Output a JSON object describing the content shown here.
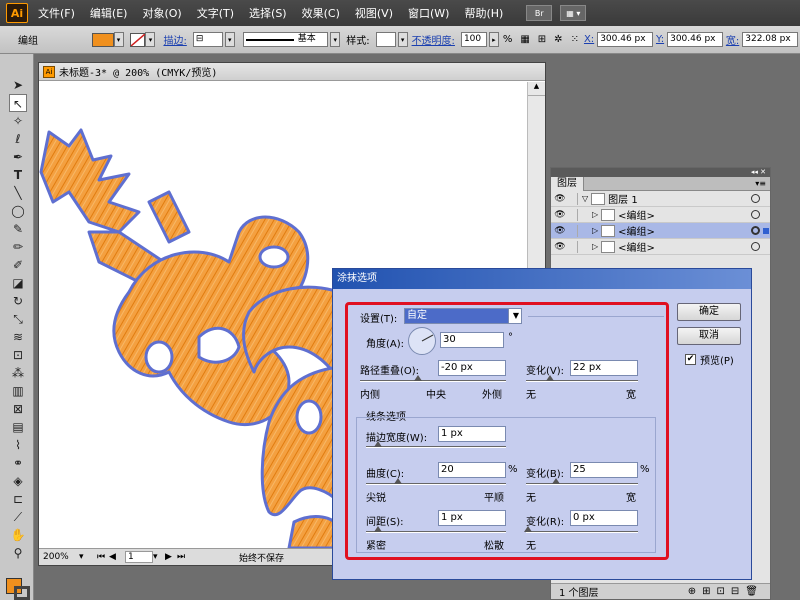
{
  "menubar": {
    "logo": "Ai",
    "items": [
      "文件(F)",
      "编辑(E)",
      "对象(O)",
      "文字(T)",
      "选择(S)",
      "效果(C)",
      "视图(V)",
      "窗口(W)",
      "帮助(H)"
    ],
    "br_label": "Br"
  },
  "controlbar": {
    "selection_type": "编组",
    "stroke_label": "描边:",
    "stroke_style": "基本",
    "style_label": "样式:",
    "opacity_label": "不透明度:",
    "opacity_value": "100",
    "opacity_unit": "%",
    "x_label": "X:",
    "x_value": "300.46 px",
    "y_label": "Y:",
    "y_value": "300.46 px",
    "w_label": "宽:",
    "w_value": "322.08 px",
    "fill_color": "#f0901e",
    "stroke_color": "#d02020"
  },
  "document": {
    "title": "未标题-3* @ 200% (CMYK/预览)",
    "zoom": "200%",
    "page": "1",
    "status": "始终不保存"
  },
  "layers": {
    "tab": "图层",
    "rows": [
      {
        "name": "图层 1",
        "selected": false
      },
      {
        "name": "<编组>",
        "selected": false
      },
      {
        "name": "<编组>",
        "selected": true
      },
      {
        "name": "<编组>",
        "selected": false
      }
    ],
    "footer": "1 个图层"
  },
  "dialog": {
    "title": "涂抹选项",
    "setting_label": "设置(T):",
    "setting_value": "自定",
    "angle_label": "角度(A):",
    "angle_value": "30",
    "angle_unit": "°",
    "overlap_label": "路径重叠(O):",
    "overlap_value": "-20 px",
    "overlap_var_label": "变化(V):",
    "overlap_var_value": "22 px",
    "overlap_left": "内侧",
    "overlap_mid": "中央",
    "overlap_right": "外侧",
    "var_left": "无",
    "var_right": "宽",
    "line_group": "线条选项",
    "stroke_width_label": "描边宽度(W):",
    "stroke_width_value": "1 px",
    "curve_label": "曲度(C):",
    "curve_value": "20",
    "curve_unit": "%",
    "curve_var_label": "变化(B):",
    "curve_var_value": "25",
    "curve_var_unit": "%",
    "curve_left": "尖锐",
    "curve_right": "平顺",
    "curve_var_left": "无",
    "curve_var_right": "宽",
    "spacing_label": "间距(S):",
    "spacing_value": "1 px",
    "spacing_var_label": "变化(R):",
    "spacing_var_value": "0 px",
    "spacing_left": "紧密",
    "spacing_right": "松散",
    "spacing_var_left": "无",
    "ok": "确定",
    "cancel": "取消",
    "preview": "预览(P)",
    "preview_checked": true
  }
}
